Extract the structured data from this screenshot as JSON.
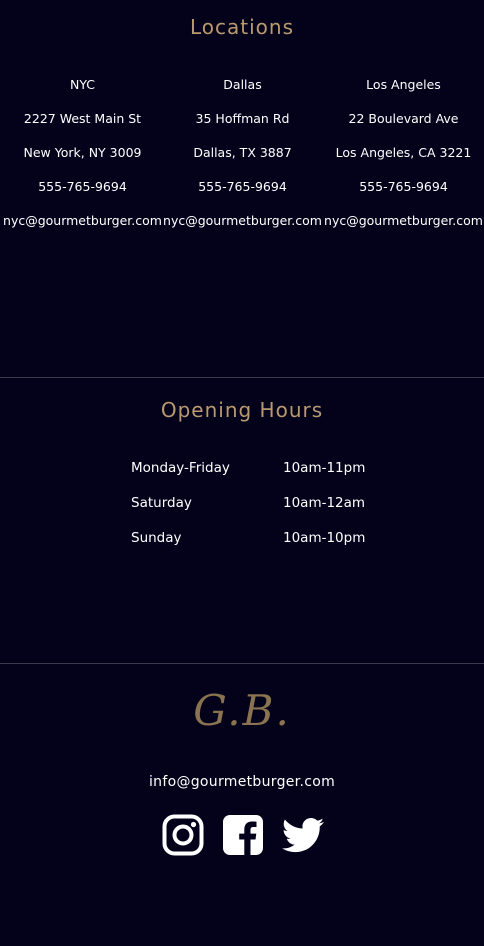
{
  "locations": {
    "title": "Locations",
    "items": [
      {
        "city": "NYC",
        "address": "2227 West Main St",
        "city_state": "New York, NY 3009",
        "phone": "555-765-9694",
        "email": "nyc@gourmetburger.com"
      },
      {
        "city": "Dallas",
        "address": "35 Hoffman Rd",
        "city_state": "Dallas, TX 3887",
        "phone": "555-765-9694",
        "email": "nyc@gourmetburger.com"
      },
      {
        "city": "Los Angeles",
        "address": "22 Boulevard Ave",
        "city_state": "Los Angeles, CA 3221",
        "phone": "555-765-9694",
        "email": "nyc@gourmetburger.com"
      }
    ]
  },
  "hours": {
    "title": "Opening Hours",
    "rows": [
      {
        "day": "Monday-Friday",
        "time": "10am-11pm"
      },
      {
        "day": "Saturday",
        "time": "10am-12am"
      },
      {
        "day": "Sunday",
        "time": "10am-10pm"
      }
    ]
  },
  "footer": {
    "logo": "G.B.",
    "email": "info@gourmetburger.com",
    "social": [
      {
        "icon": "instagram-icon"
      },
      {
        "icon": "facebook-icon"
      },
      {
        "icon": "twitter-icon"
      }
    ]
  },
  "colors": {
    "background": "#03021a",
    "accent": "#b99a70",
    "logo": "#8a7350",
    "divider": "#3c3a4c",
    "text": "#ffffff"
  }
}
